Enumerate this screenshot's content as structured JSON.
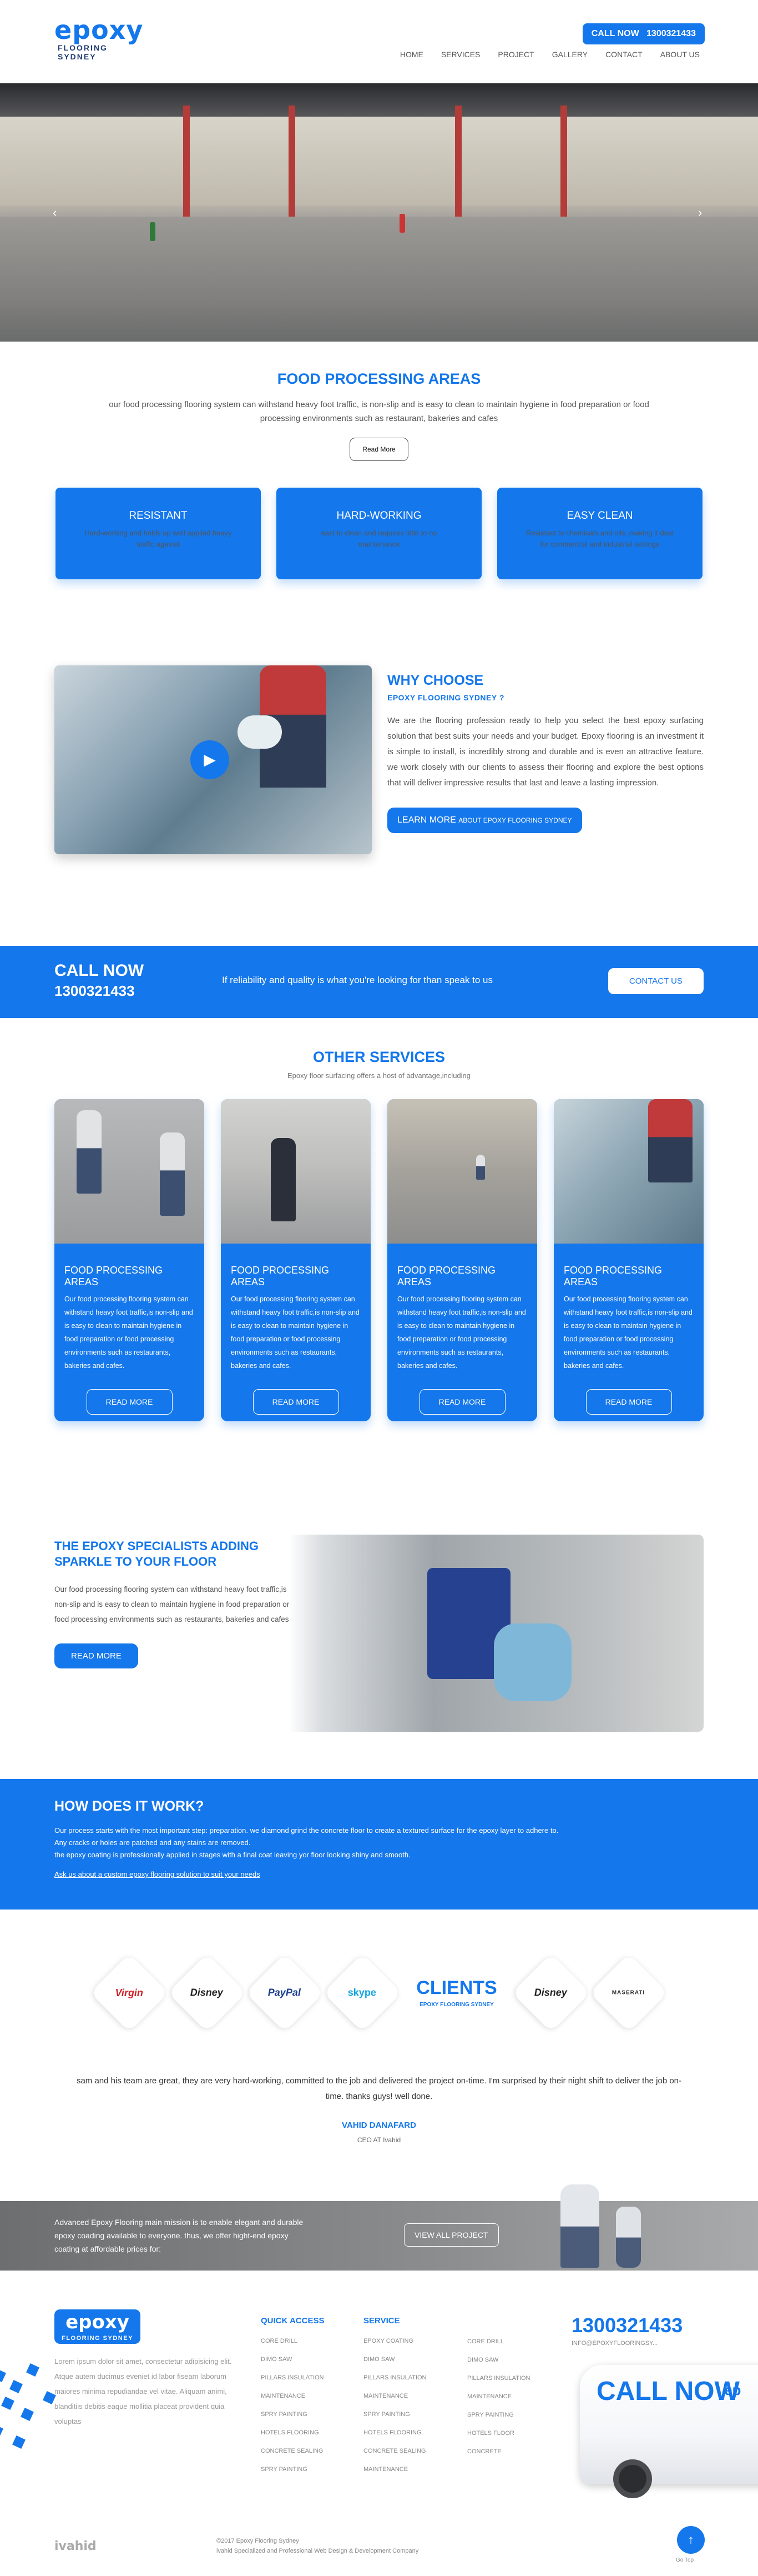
{
  "header": {
    "logo_word": "epoxy",
    "logo_sub": "FLOORING SYDNEY",
    "call_label": "CALL NOW",
    "call_number": "1300321433",
    "nav": [
      "HOME",
      "SERVICES",
      "PROJECT",
      "GALLERY",
      "CONTACT",
      "ABOUT US"
    ]
  },
  "hero": {
    "prev": "‹",
    "next": "›"
  },
  "food": {
    "title": "FOOD PROCESSING AREAS",
    "text": "our food processing flooring system can withstand heavy foot traffic, is non-slip and is easy to clean to maintain hygiene in food preparation or food processing environments such as restaurant, bakeries and cafes",
    "button": "Read More"
  },
  "features": [
    {
      "title": "RESISTANT",
      "text": "Hard-working and holds up well applied heavy traffic against"
    },
    {
      "title": "HARD-WORKING",
      "text": "east to clean and requires little to no maintenance"
    },
    {
      "title": "EASY CLEAN",
      "text": "Resistant to chemicals and oils, making it deal for commerical and industrial settings"
    }
  ],
  "why": {
    "title": "WHY CHOOSE",
    "subtitle": "EPOXY FLOORING SYDNEY ?",
    "text": "We are the flooring profession ready to help you select the best epoxy surfacing solution that best suits your needs and your budget. Epoxy flooring is an investment it is simple to install, is incredibly strong and durable and is even an attractive feature. we work closely with our clients to assess their flooring and explore the best options that will deliver impressive results that last and leave a lasting impression.",
    "button_main": "LEARN MORE",
    "button_small": "ABOUT EPOXY FLOORING SYDNEY",
    "play_icon": "▶"
  },
  "band": {
    "call": "CALL NOW",
    "number": "1300321433",
    "message": "If reliability and quality is what you're looking for than speak to us",
    "button": "CONTACT US"
  },
  "services": {
    "title": "OTHER SERVICES",
    "subtitle": "Epoxy floor surfacing offers a host of advantage,including",
    "cards": [
      {
        "title": "FOOD PROCESSING AREAS",
        "text": "Our food processing flooring system can withstand heavy foot traffic,is non-slip and is easy to clean to maintain hygiene in food preparation or food processing environments such as restaurants, bakeries and cafes.",
        "button": "READ MORE"
      },
      {
        "title": "FOOD PROCESSING AREAS",
        "text": "Our food processing flooring system can withstand heavy foot traffic,is non-slip and is easy to clean to maintain hygiene in food preparation or food processing environments such as restaurants, bakeries and cafes.",
        "button": "READ MORE"
      },
      {
        "title": "FOOD PROCESSING AREAS",
        "text": "Our food processing flooring system can withstand heavy foot traffic,is non-slip and is easy to clean to maintain hygiene in food preparation or food processing environments such as restaurants, bakeries and cafes.",
        "button": "READ MORE"
      },
      {
        "title": "FOOD PROCESSING AREAS",
        "text": "Our food processing flooring system can withstand heavy foot traffic,is non-slip and is easy to clean to maintain hygiene in food preparation or food processing environments such as restaurants, bakeries and cafes.",
        "button": "READ MORE"
      }
    ]
  },
  "specialists": {
    "title": "THE EPOXY SPECIALISTS ADDING SPARKLE TO YOUR FLOOR",
    "text": "Our food processing flooring system can withstand heavy foot traffic,is non-slip and is easy to clean to maintain hygiene in food preparation or food processing environments such as restaurants, bakeries and cafes",
    "button": "READ MORE"
  },
  "how": {
    "title": "HOW DOES IT WORK?",
    "line1": "Our process starts with the most important step: preparation. we diamond grind the concrete floor to create a textured surface for the epoxy layer to adhere to.",
    "line2": "Any cracks or holes are patched and any stains are removed.",
    "line3": "the epoxy coating is professionally applied in stages with a final coat leaving yor floor looking shiny and smooth.",
    "link": "Ask us about a custom epoxy flooring solution to suit your needs"
  },
  "clients": {
    "logos": [
      "Virgin",
      "Disney",
      "PayPal",
      "skype"
    ],
    "title": "CLIENTS",
    "title_sub": "EPOXY FLOORING SYDNEY",
    "logos_right": [
      "Disney",
      "MASERATI"
    ],
    "quote": "sam and his team are great, they are very hard-working, committed to the job and delivered the project on-time. I'm surprised by their night shift to deliver the job on-time. thanks guys! well done.",
    "name": "VAHID DANAFARD",
    "role": "CEO AT Ivahid"
  },
  "mission": {
    "text": "Advanced Epoxy Flooring main mission is to enable elegant and durable epoxy coading available to everyone. thus, we offer hight-end epoxy coating at affordable prices for:",
    "button": "VIEW ALL PROJECT"
  },
  "footer": {
    "logo_word": "epoxy",
    "logo_sub": "FLOORING SYDNEY",
    "about": "Lorem ipsum dolor sit amet, consectetur adipisicing elit. Atque autem ducimus eveniet id labor fiseam laborum maiores minima repudiandae vel vitae. Aliquam animi, blanditiis debitis eaque mollitia placeat provident quia voluptas",
    "quick_title": "QUICK ACCESS",
    "quick": [
      "CORE DRILL",
      "DIMO SAW",
      "PILLARS INSULATION",
      "MAINTENANCE",
      "SPRY PAINTING",
      "HOTELS FLOORING",
      "CONCRETE SEALING",
      "SPRY PAINTING"
    ],
    "service_title": "SERVICE",
    "service": [
      "EPOXY COATING",
      "DIMO SAW",
      "PILLARS INSULATION",
      "MAINTENANCE",
      "SPRY PAINTING",
      "HOTELS FLOORING",
      "CONCRETE SEALING",
      "MAINTENANCE"
    ],
    "extra": [
      "CORE DRILL",
      "DIMO SAW",
      "PILLARS INSULATION",
      "MAINTENANCE",
      "SPRY PAINTING",
      "HOTELS FLOOR",
      "CONCRETE"
    ],
    "phone": "1300321433",
    "email": "INFO@EPOXYFLOORINGSY...",
    "van_call": "CALL NOW",
    "van_brand": "ep",
    "brand": "ivahid",
    "copyright": "©2017 Epoxy Flooring Sydney",
    "credit": "ivahid Specialized and Professional Web Design & Development Company",
    "to_top_icon": "↑",
    "to_top_label": "Go Top"
  }
}
